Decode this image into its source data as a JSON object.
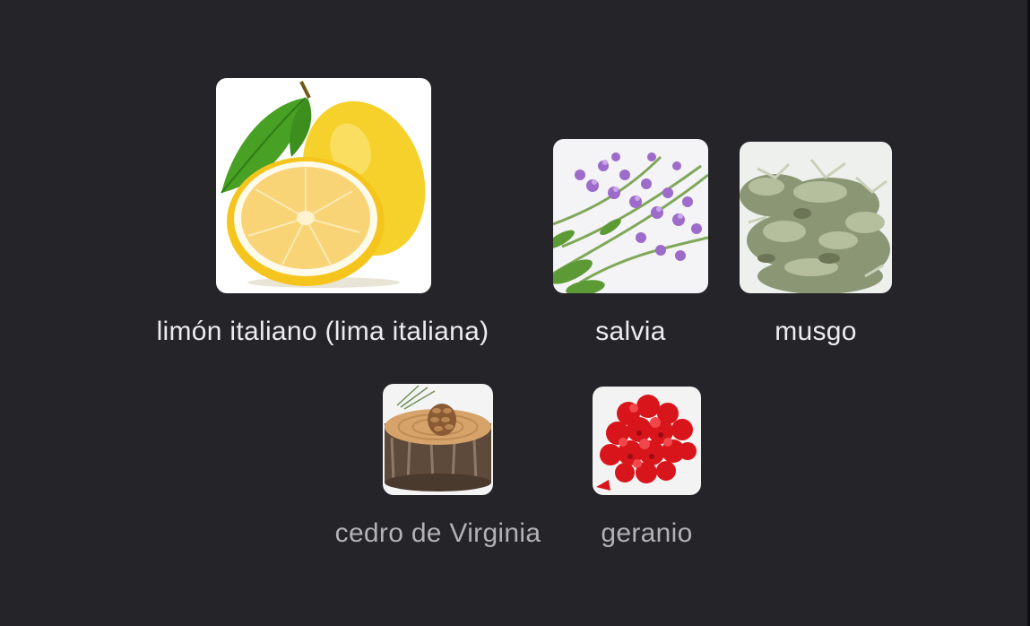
{
  "notes": {
    "primary": [
      {
        "id": "lemon",
        "label": "limón italiano (lima italiana)",
        "icon": "lemon-icon"
      },
      {
        "id": "sage",
        "label": "salvia",
        "icon": "sage-icon"
      },
      {
        "id": "moss",
        "label": "musgo",
        "icon": "moss-icon"
      }
    ],
    "secondary": [
      {
        "id": "cedar",
        "label": "cedro de Virginia",
        "icon": "cedar-log-icon"
      },
      {
        "id": "geranium",
        "label": "geranio",
        "icon": "geranium-icon"
      }
    ]
  },
  "colors": {
    "background": "#252429",
    "primary_text": "#ecebef",
    "secondary_text": "#b2b1b7"
  }
}
